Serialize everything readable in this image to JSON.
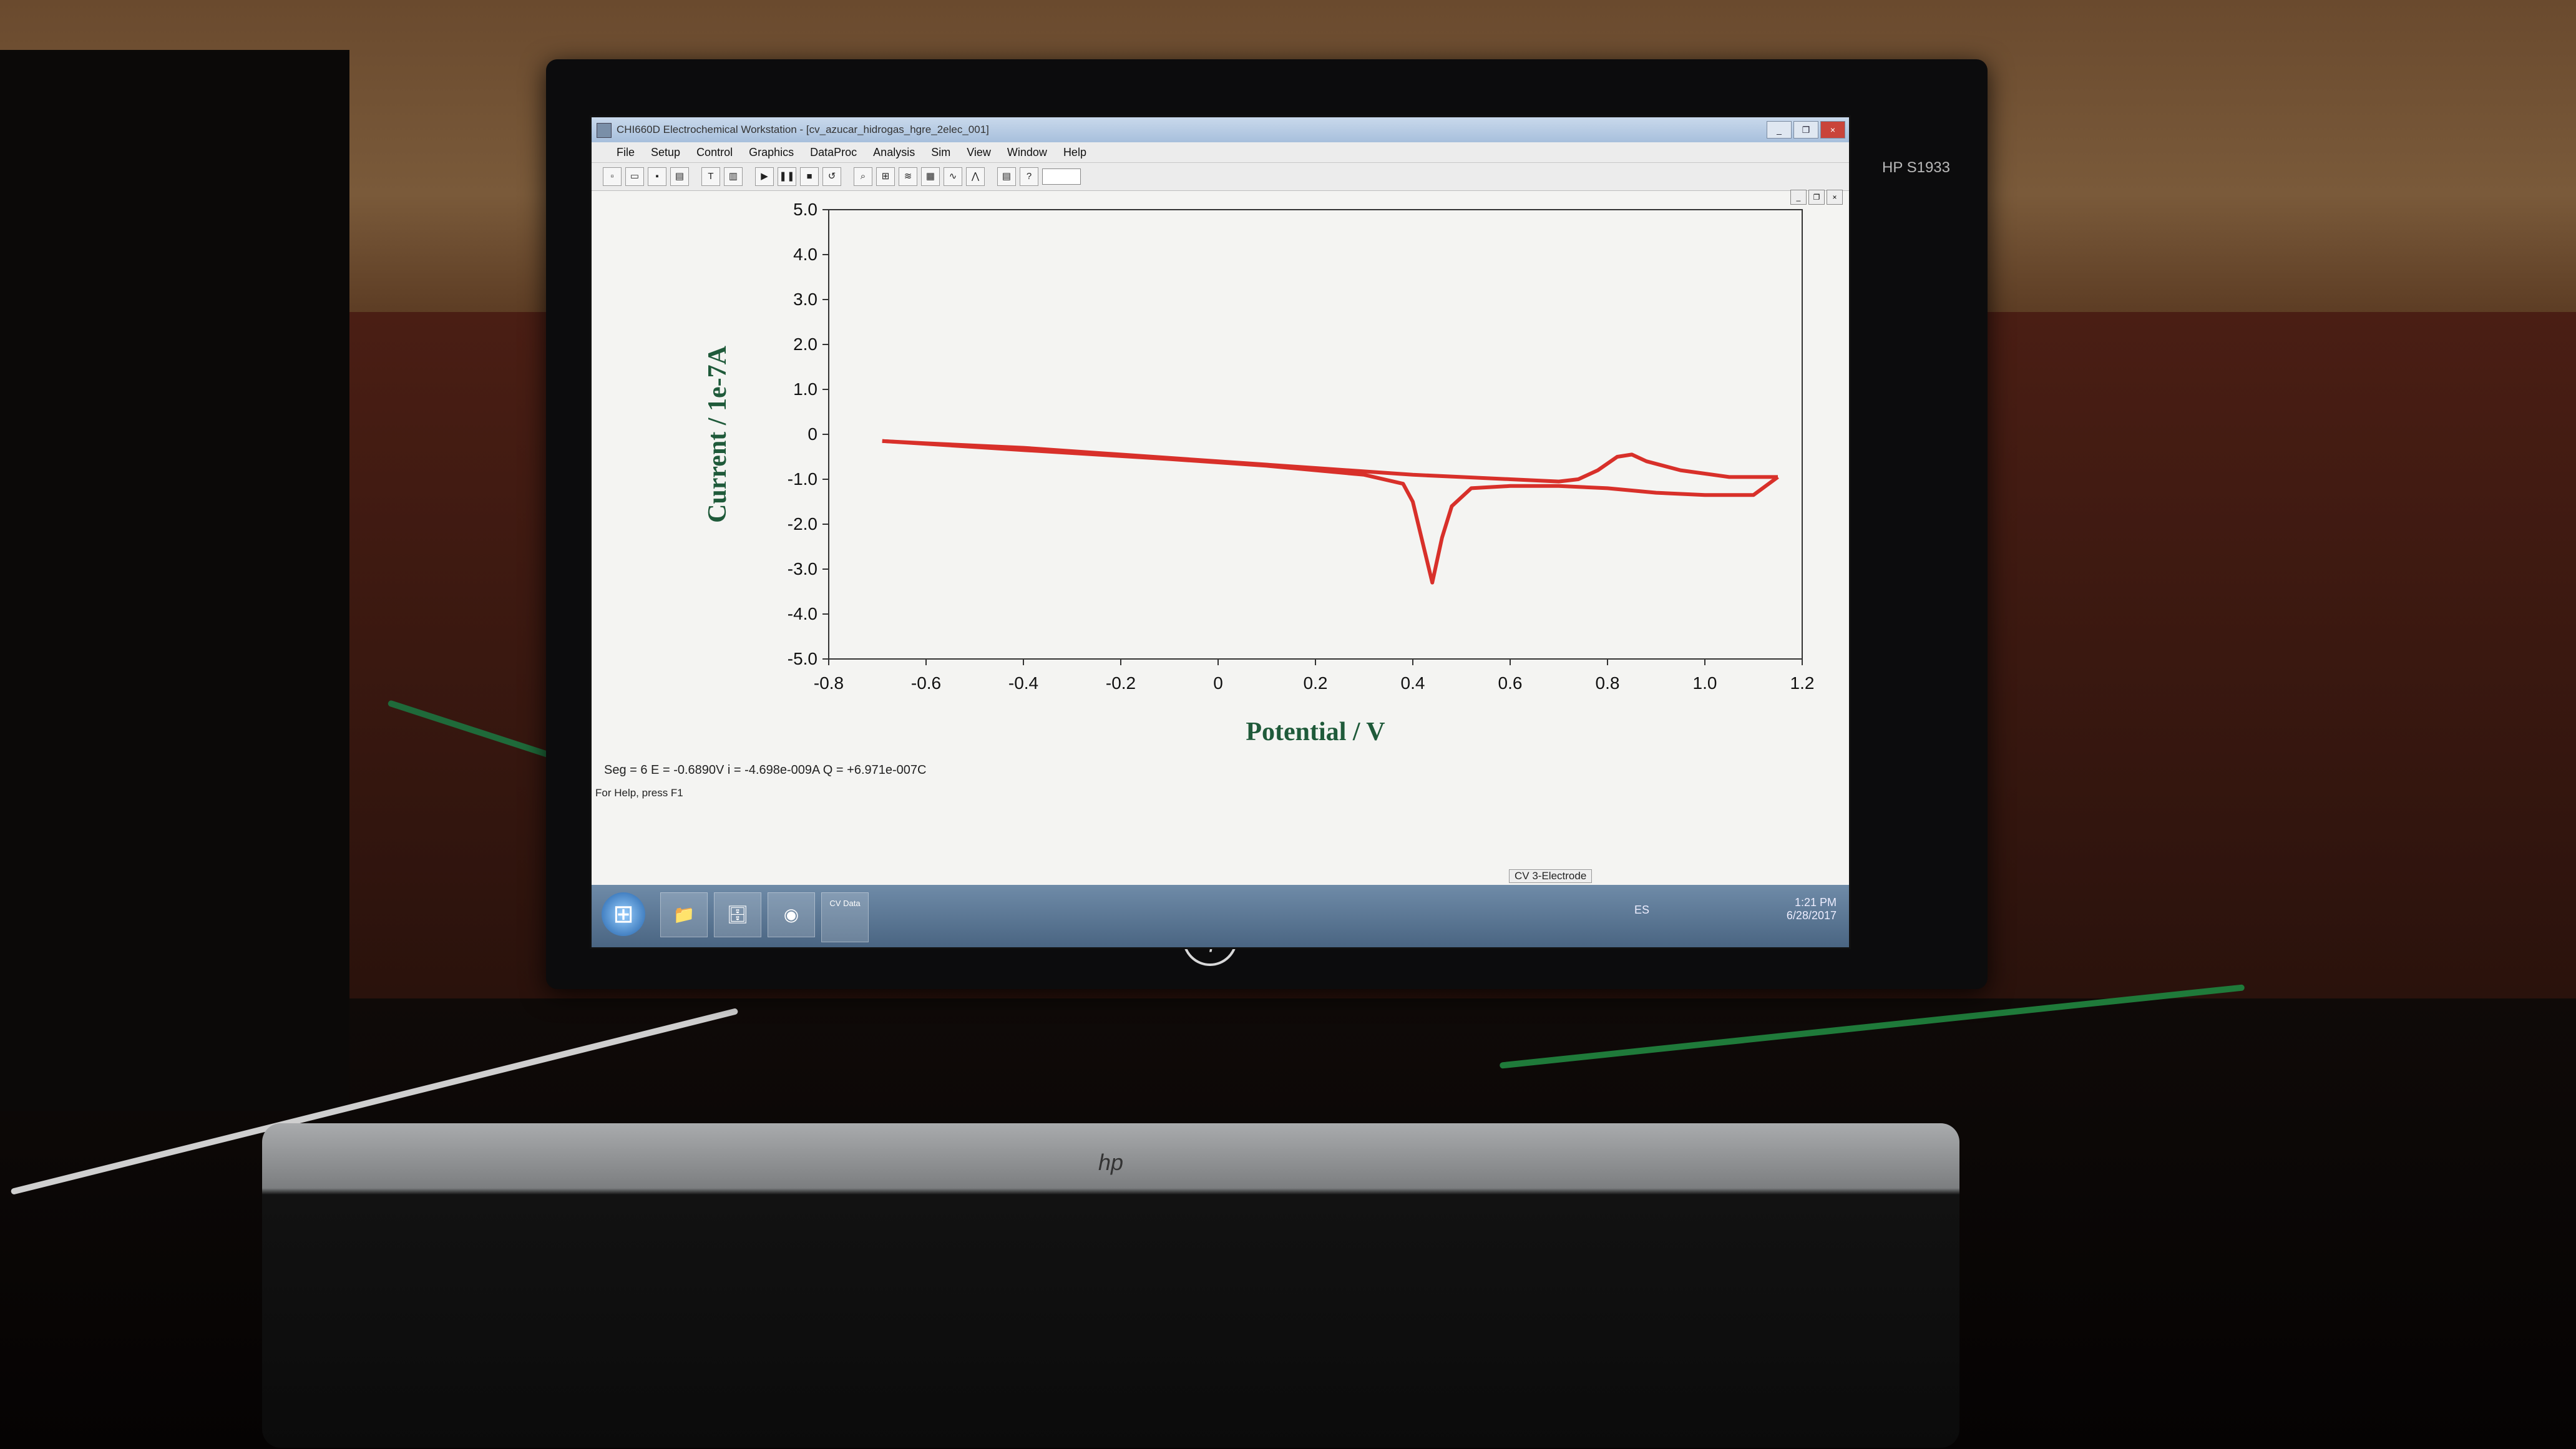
{
  "window": {
    "title": "CHI660D Electrochemical Workstation - [cv_azucar_hidrogas_hgre_2elec_001]",
    "minimize": "_",
    "restore": "❐",
    "close": "×"
  },
  "menu": [
    "File",
    "Setup",
    "Control",
    "Graphics",
    "DataProc",
    "Analysis",
    "Sim",
    "View",
    "Window",
    "Help"
  ],
  "toolbar_icons": [
    "new-icon",
    "open-icon",
    "save-icon",
    "print-icon",
    "technique-icon",
    "parameters-icon",
    "run-icon",
    "pause-icon",
    "stop-icon",
    "reverse-icon",
    "zoom-icon",
    "graph-icon",
    "overlay-icon",
    "color-icon",
    "help-icon"
  ],
  "monitor": {
    "model": "HP S1933",
    "brand": "hp"
  },
  "chart_data": {
    "type": "line",
    "xlabel": "Potential / V",
    "ylabel": "Current / 1e-7A",
    "xlim": [
      -0.8,
      1.2
    ],
    "ylim": [
      -5.0,
      5.0
    ],
    "x_ticks": [
      "-0.8",
      "-0.6",
      "-0.4",
      "-0.2",
      "0",
      "0.2",
      "0.4",
      "0.6",
      "0.8",
      "1.0",
      "1.2"
    ],
    "y_ticks": [
      "5.0",
      "4.0",
      "3.0",
      "2.0",
      "1.0",
      "0",
      "-1.0",
      "-2.0",
      "-3.0",
      "-4.0",
      "-5.0"
    ],
    "grid": false,
    "color": "#d8302a",
    "series": [
      {
        "x": [
          -0.69,
          -0.4,
          -0.1,
          0.1,
          0.3,
          0.38,
          0.4,
          0.42,
          0.44,
          0.46,
          0.48,
          0.52,
          0.6,
          0.7,
          0.8,
          0.9,
          1.0,
          1.1,
          1.15
        ],
        "y": [
          -0.15,
          -0.35,
          -0.55,
          -0.7,
          -0.9,
          -1.1,
          -1.5,
          -2.4,
          -3.3,
          -2.3,
          -1.6,
          -1.2,
          -1.15,
          -1.15,
          -1.2,
          -1.3,
          -1.35,
          -1.35,
          -0.95
        ]
      },
      {
        "x": [
          1.15,
          1.05,
          0.95,
          0.88,
          0.85,
          0.82,
          0.78,
          0.74,
          0.7,
          0.6,
          0.5,
          0.4,
          0.2,
          0.0,
          -0.2,
          -0.4,
          -0.6,
          -0.69
        ],
        "y": [
          -0.95,
          -0.95,
          -0.8,
          -0.6,
          -0.45,
          -0.5,
          -0.8,
          -1.0,
          -1.05,
          -1.0,
          -0.95,
          -0.9,
          -0.75,
          -0.6,
          -0.45,
          -0.3,
          -0.2,
          -0.15
        ]
      }
    ]
  },
  "status": {
    "readout": "Seg = 6  E = -0.6890V   i = -4.698e-009A   Q = +6.971e-007C",
    "help": "For Help, press F1",
    "mode": "CV     3-Electrode"
  },
  "taskbar": {
    "start": "⊞",
    "items": [
      "📁",
      "🗄",
      "◉"
    ],
    "app_label": "CV Data",
    "lang": "ES",
    "time": "1:21 PM",
    "date": "6/28/2017"
  },
  "keyboard": {
    "brand": "hp"
  }
}
